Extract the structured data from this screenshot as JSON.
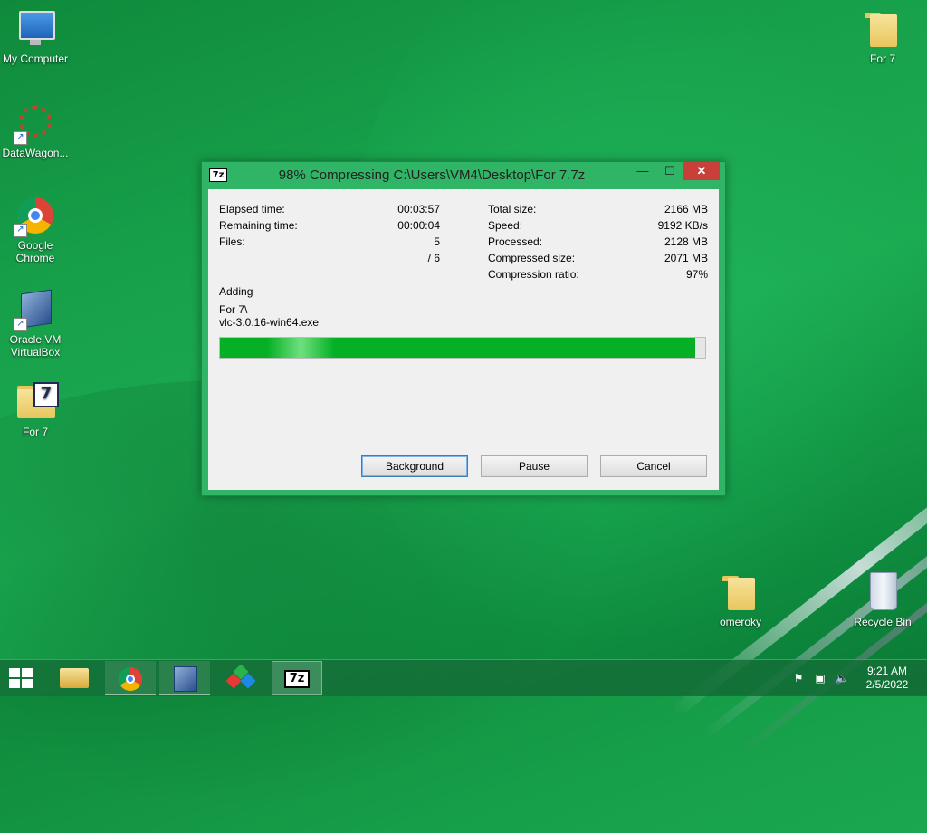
{
  "desktop": {
    "icons": [
      {
        "label": "My Computer"
      },
      {
        "label": "DataWagon..."
      },
      {
        "label": "Google Chrome"
      },
      {
        "label": "Oracle VM VirtualBox"
      },
      {
        "label": "For 7"
      },
      {
        "label": "For 7"
      },
      {
        "label": "omeroky"
      },
      {
        "label": "Recycle Bin"
      }
    ]
  },
  "dialog": {
    "app_icon": "7z",
    "title": "98% Compressing C:\\Users\\VM4\\Desktop\\For 7.7z",
    "controls": {
      "minimize": "—",
      "maximize": "☐",
      "close": "✕"
    },
    "left_stats": [
      {
        "label": "Elapsed time:",
        "value": "00:03:57"
      },
      {
        "label": "Remaining time:",
        "value": "00:00:04"
      },
      {
        "label": "Files:",
        "value": "5"
      },
      {
        "label": "",
        "value": "/ 6"
      }
    ],
    "right_stats": [
      {
        "label": "Total size:",
        "value": "2166 MB"
      },
      {
        "label": "Speed:",
        "value": "9192 KB/s"
      },
      {
        "label": "Processed:",
        "value": "2128 MB"
      },
      {
        "label": "Compressed size:",
        "value": "2071 MB"
      },
      {
        "label": "Compression ratio:",
        "value": "97%"
      }
    ],
    "status_label": "Adding",
    "current_folder": "For 7\\",
    "current_file": "vlc-3.0.16-win64.exe",
    "progress_percent": 98,
    "buttons": {
      "background": "Background",
      "pause": "Pause",
      "cancel": "Cancel"
    }
  },
  "taskbar": {
    "items": [
      {
        "icon": "file-explorer-icon"
      },
      {
        "icon": "chrome-icon"
      },
      {
        "icon": "virtualbox-icon"
      },
      {
        "icon": "app-cubes-icon"
      },
      {
        "icon": "7zip-icon",
        "label": "7z"
      }
    ],
    "clock": {
      "time": "9:21 AM",
      "date": "2/5/2022"
    }
  },
  "colors": {
    "accent": "#2fb565",
    "progress": "#06b025",
    "close": "#c9403a"
  }
}
